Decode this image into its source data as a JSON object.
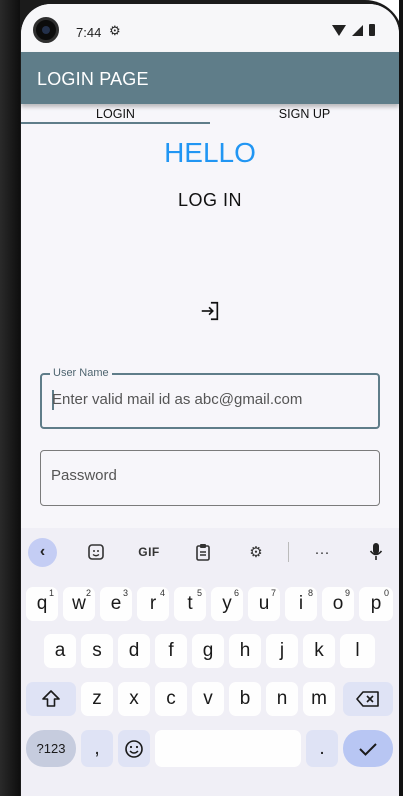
{
  "status_bar": {
    "time": "7:44",
    "settings_icon": "gear-icon"
  },
  "app_bar": {
    "title": "LOGIN PAGE"
  },
  "tabs": [
    {
      "label": "LOGIN",
      "selected": true
    },
    {
      "label": "SIGN UP",
      "selected": false
    }
  ],
  "main": {
    "greeting": "HELLO",
    "heading": "LOG IN",
    "login_icon": "login-icon"
  },
  "form": {
    "username": {
      "label": "User Name",
      "placeholder": "Enter valid mail id as abc@gmail.com",
      "value": ""
    },
    "password": {
      "placeholder": "Password",
      "value": ""
    }
  },
  "keyboard": {
    "toolbar": {
      "gif_label": "GIF",
      "more_label": "···"
    },
    "row1": [
      {
        "key": "q",
        "hint": "1"
      },
      {
        "key": "w",
        "hint": "2"
      },
      {
        "key": "e",
        "hint": "3"
      },
      {
        "key": "r",
        "hint": "4"
      },
      {
        "key": "t",
        "hint": "5"
      },
      {
        "key": "y",
        "hint": "6"
      },
      {
        "key": "u",
        "hint": "7"
      },
      {
        "key": "i",
        "hint": "8"
      },
      {
        "key": "o",
        "hint": "9"
      },
      {
        "key": "p",
        "hint": "0"
      }
    ],
    "row2": [
      "a",
      "s",
      "d",
      "f",
      "g",
      "h",
      "j",
      "k",
      "l"
    ],
    "row3": [
      "z",
      "x",
      "c",
      "v",
      "b",
      "n",
      "m"
    ],
    "bottom": {
      "symbols": "?123",
      "comma": ",",
      "period": "."
    }
  },
  "colors": {
    "accent": "#5f7d89",
    "hello": "#2196f3"
  }
}
